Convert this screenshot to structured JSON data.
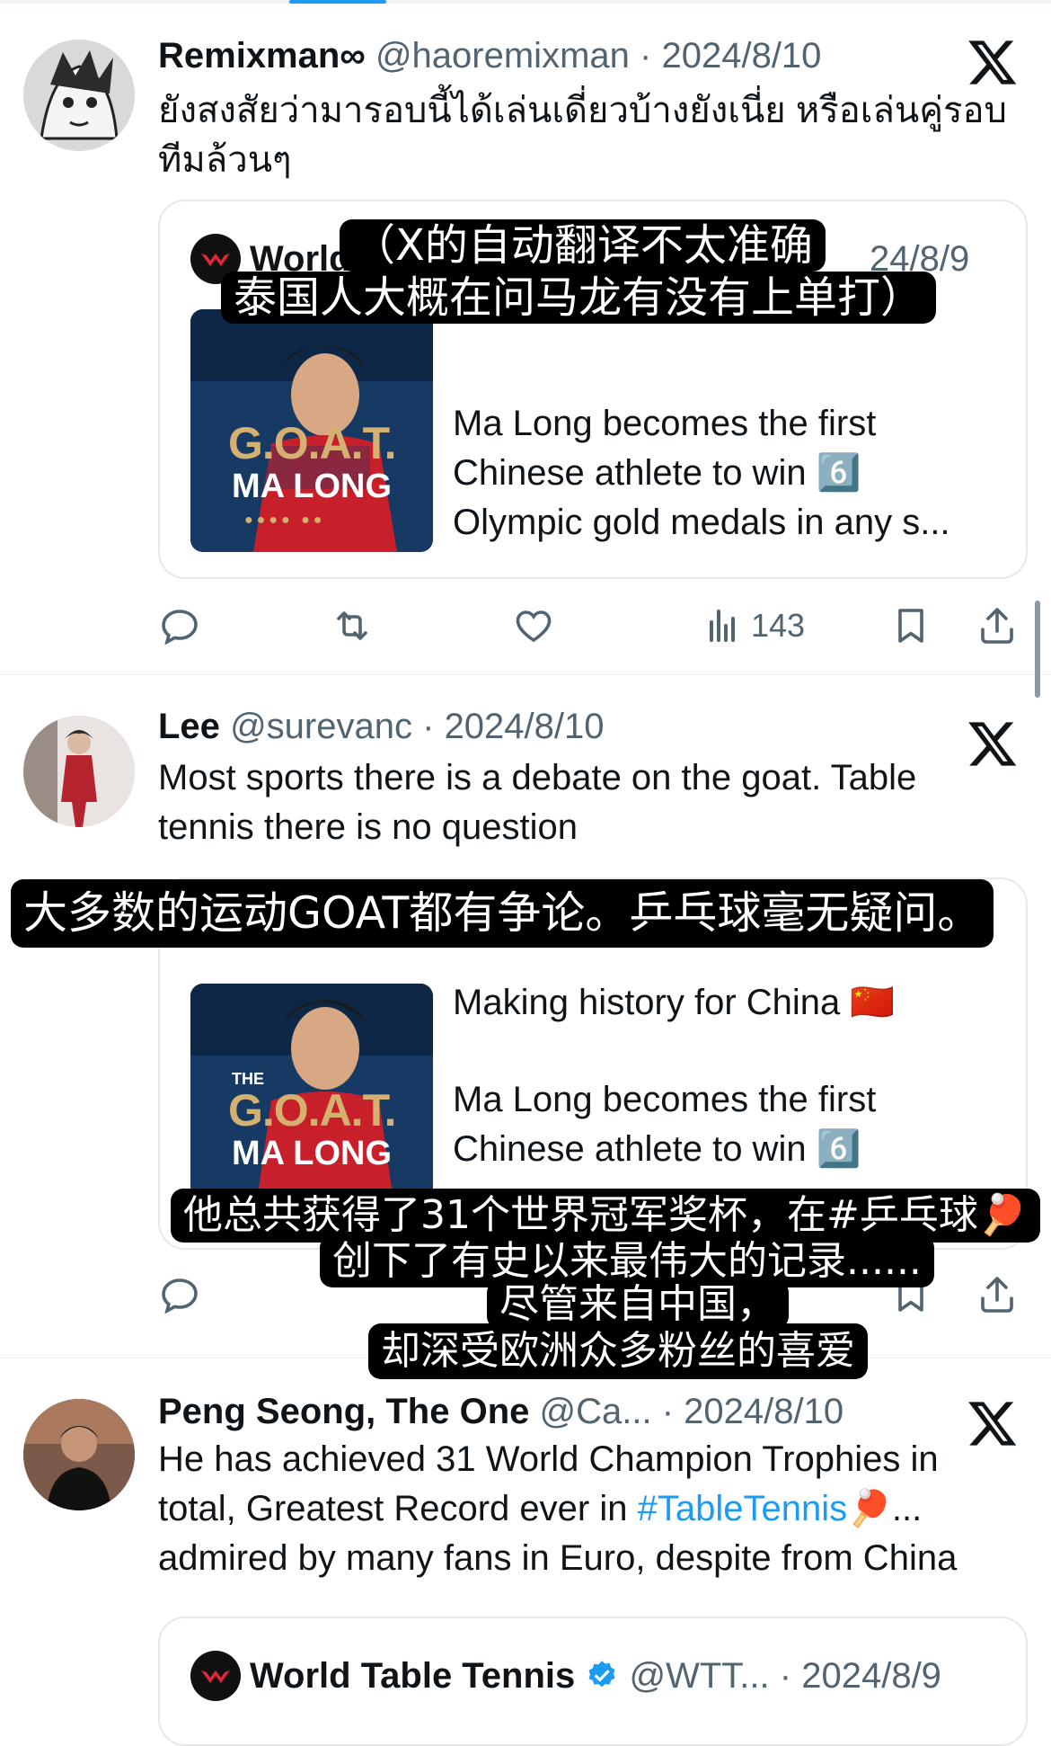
{
  "tweets": [
    {
      "name": "Remixman∞",
      "handle": "@haoremixman",
      "date": "2024/8/10",
      "text": "ยังสงสัยว่ามารอบนี้ได้เล่นเดี่ยวบ้างยังเนี่ย หรือเล่นคู่รอบทีมล้วนๆ",
      "card": {
        "source_name": "World",
        "source_date": "24/8/9",
        "thumb_title": "G.O.A.T.",
        "thumb_subtitle": "MA LONG",
        "text": "Ma Long becomes the first Chinese athlete to win 6️⃣ Olympic gold medals in any s..."
      },
      "views": "143"
    },
    {
      "name": "Lee",
      "handle": "@surevanc",
      "date": "2024/8/10",
      "text": "Most sports there is a debate on the goat. Table tennis there is no question",
      "card": {
        "thumb_title": "G.O.A.T.",
        "thumb_kicker": "THE",
        "thumb_subtitle": "MA LONG",
        "line1": "Making history for China 🇨🇳",
        "line2": "Ma Long becomes the first Chinese athlete to win 6️⃣"
      }
    },
    {
      "name": "Peng Seong, The One",
      "handle": "@Ca...",
      "date": "2024/8/10",
      "text_before": "He has achieved 31 World Champion Trophies in total, Greatest Record ever in ",
      "hashtag": "#TableTennis",
      "text_after": "🏓... admired by many fans in Euro, despite from China",
      "card": {
        "source_name": "World Table Tennis",
        "source_handle": "@WTT...",
        "source_date": "2024/8/9"
      }
    }
  ],
  "subtitles": {
    "s1_line1": "（X的自动翻译不太准确",
    "s1_line2": "泰国人大概在问马龙有没有上单打）",
    "s2": "大多数的运动GOAT都有争论。乒乓球毫无疑问。",
    "s3_line1": "他总共获得了31个世界冠军奖杯，在#乒乓球🏓",
    "s3_line2": "创下了有史以来最伟大的记录......",
    "s3_line3": "尽管来自中国，",
    "s3_line4": "却深受欧洲众多粉丝的喜爱"
  },
  "colors": {
    "text": "#0f1419",
    "secondary": "#536471",
    "link": "#1d9bf0",
    "verified": "#1d9bf0",
    "subtitle_bg": "#000000"
  },
  "icons": [
    "reply-icon",
    "repost-icon",
    "like-icon",
    "views-icon",
    "bookmark-icon",
    "share-icon",
    "x-logo-icon",
    "verified-badge-icon"
  ]
}
